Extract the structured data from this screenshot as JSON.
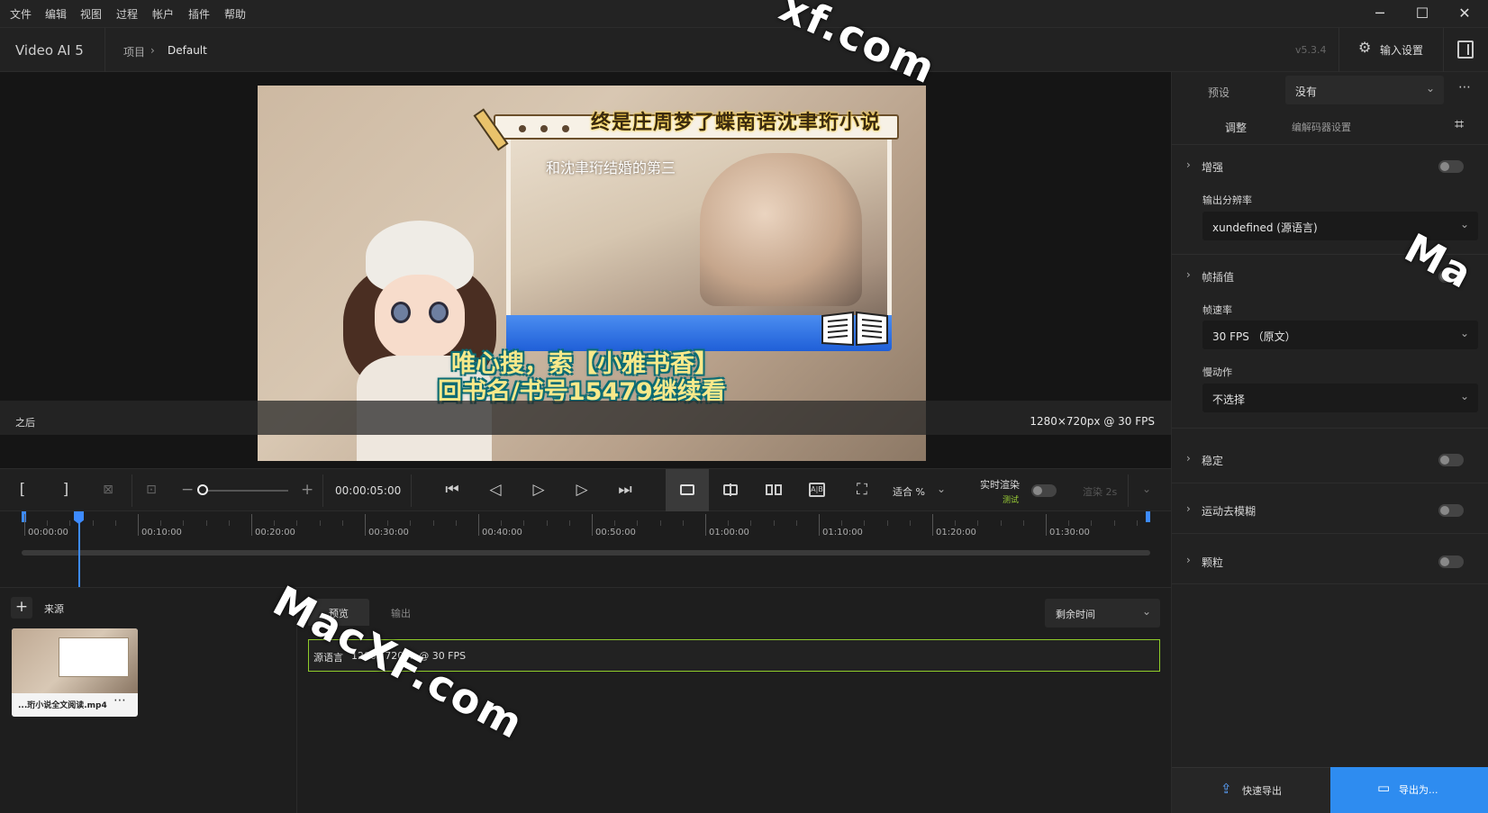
{
  "menu": [
    "文件",
    "编辑",
    "视图",
    "过程",
    "帐户",
    "插件",
    "帮助"
  ],
  "window_controls": {
    "minimize": "─",
    "maximize": "☐",
    "close": "✕"
  },
  "header": {
    "app_title": "Video AI 5",
    "breadcrumb_root": "项目",
    "breadcrumb_current": "Default",
    "version": "v5.3.4",
    "input_settings": "输入设置"
  },
  "viewer": {
    "after_label": "之后",
    "resolution": "1280×720px @ 30 FPS",
    "video_title": "终是庄周梦了蝶南语沈聿珩小说",
    "video_subtitle": "和沈聿珩结婚的第三",
    "promo_line1": "唯心搜，索【小雅书香】",
    "promo_line2": "回书名/书号15479继续看"
  },
  "transport": {
    "in_mark": "[",
    "out_mark": "]",
    "timecode": "00:00:05:00",
    "fit_label": "适合 %",
    "realtime_label": "实时渲染",
    "realtime_badge": "测试",
    "render_label": "渲染 2s"
  },
  "timeline": {
    "labels": [
      "00:00:00",
      "00:10:00",
      "00:20:00",
      "00:30:00",
      "00:40:00",
      "00:50:00",
      "01:00:00",
      "01:10:00",
      "01:20:00",
      "01:30:00"
    ]
  },
  "source": {
    "title": "来源",
    "filename": "...珩小说全文阅读.mp4"
  },
  "queue": {
    "tab_preview": "预览",
    "tab_output": "输出",
    "remaining": "剩余时间",
    "row_source": "源语言",
    "row_info": "1280×720px @ 30 FPS"
  },
  "right_panel": {
    "preset_label": "预设",
    "preset_value": "没有",
    "tab_adjust": "调整",
    "tab_codec": "编解码器设置",
    "enhance": "增强",
    "output_res_label": "输出分辨率",
    "output_res_value": "xundefined (源语言)",
    "frame_interp": "帧插值",
    "frame_rate_label": "帧速率",
    "frame_rate_value": "30 FPS （原文）",
    "slowmo_label": "慢动作",
    "slowmo_value": "不选择",
    "stabilize": "稳定",
    "motion_deblur": "运动去模糊",
    "grain": "颗粒",
    "quick_export": "快速导出",
    "export_as": "导出为..."
  },
  "watermarks": {
    "main": "MacXF.com",
    "top": "xf.com",
    "side": "Ma"
  },
  "colors": {
    "accent_blue": "#2e8cf0",
    "queue_border": "#8fcc2a",
    "playhead": "#3d8bff"
  }
}
